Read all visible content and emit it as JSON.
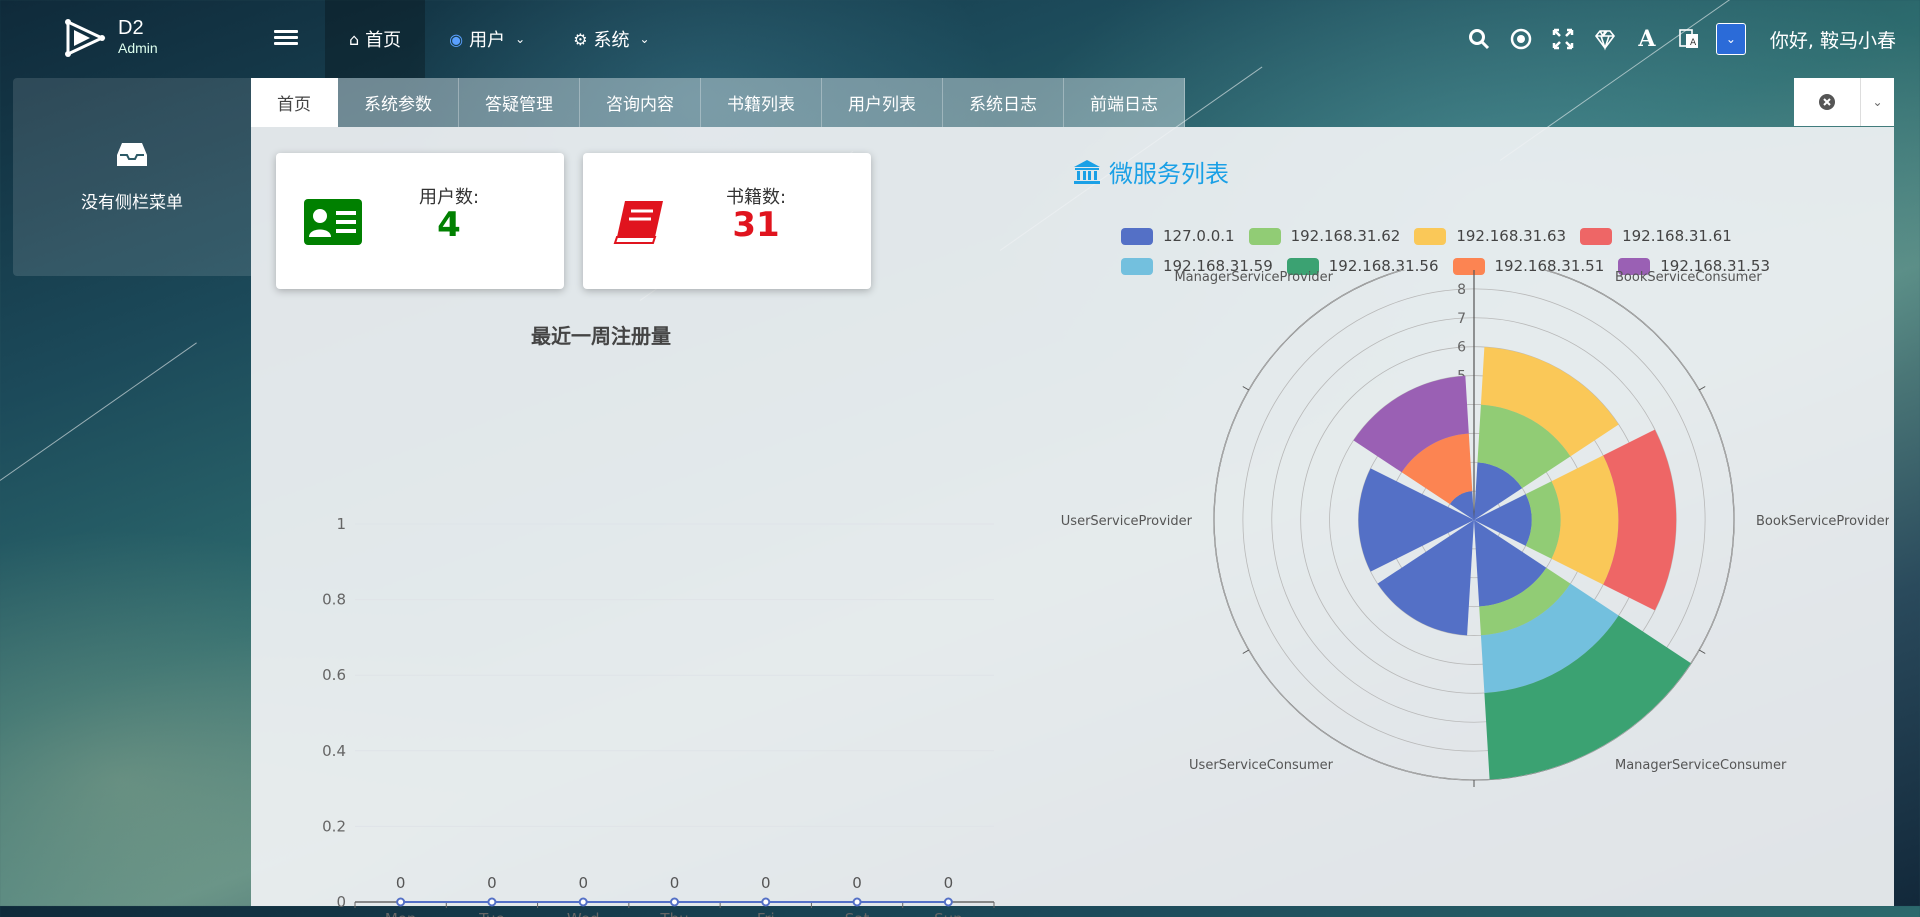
{
  "header": {
    "logo": {
      "name": "D2",
      "sub": "Admin"
    },
    "nav": [
      {
        "label": "首页",
        "icon": "home-icon"
      },
      {
        "label": "用户",
        "icon": "user-circle-icon",
        "dropdown": true
      },
      {
        "label": "系统",
        "icon": "gear-icon",
        "dropdown": true
      }
    ],
    "greeting": "你好, 鞍马小春"
  },
  "sidebar": {
    "empty_text": "没有侧栏菜单"
  },
  "tabs": [
    "首页",
    "系统参数",
    "答疑管理",
    "咨询内容",
    "书籍列表",
    "用户列表",
    "系统日志",
    "前端日志"
  ],
  "cards": [
    {
      "label": "用户数:",
      "value": "4",
      "color": "#008000",
      "icon": "id-card-icon"
    },
    {
      "label": "书籍数:",
      "value": "31",
      "color": "#e0141e",
      "icon": "book-icon"
    }
  ],
  "services_title": "微服务列表",
  "colors": {
    "accent": "#1aa0e6"
  },
  "chart_data": [
    {
      "type": "line",
      "title": "最近一周注册量",
      "categories": [
        "Mon",
        "Tue",
        "Wed",
        "Thu",
        "Fri",
        "Sat",
        "Sun"
      ],
      "values": [
        0,
        0,
        0,
        0,
        0,
        0,
        0
      ],
      "ylim": [
        0,
        1
      ],
      "yticks": [
        "0",
        "0.2",
        "0.4",
        "0.6",
        "0.8",
        "1"
      ],
      "grid": true,
      "color": "#5470c6"
    },
    {
      "type": "bar",
      "subtype": "stacked-polar",
      "categories": [
        "BookServiceConsumer",
        "BookServiceProvider",
        "ManagerServiceConsumer",
        "UserServiceConsumer",
        "UserServiceProvider",
        "ManagerServiceProvider"
      ],
      "rlim": [
        0,
        9
      ],
      "rticks": [
        "1",
        "2",
        "3",
        "4",
        "5",
        "6",
        "7",
        "8",
        "9"
      ],
      "legend_position": "top",
      "series": [
        {
          "name": "127.0.0.1",
          "color": "#5470c6",
          "values": [
            2,
            2,
            3,
            4,
            4,
            1
          ]
        },
        {
          "name": "192.168.31.62",
          "color": "#91cc75",
          "values": [
            2,
            1,
            1,
            0,
            0,
            0
          ]
        },
        {
          "name": "192.168.31.63",
          "color": "#fac858",
          "values": [
            2,
            2,
            0,
            0,
            0,
            0
          ]
        },
        {
          "name": "192.168.31.61",
          "color": "#ee6666",
          "values": [
            0,
            2,
            0,
            0,
            0,
            0
          ]
        },
        {
          "name": "192.168.31.59",
          "color": "#73c0de",
          "values": [
            0,
            0,
            2,
            0,
            0,
            0
          ]
        },
        {
          "name": "192.168.31.56",
          "color": "#3ba272",
          "values": [
            0,
            0,
            3,
            0,
            0,
            0
          ]
        },
        {
          "name": "192.168.31.51",
          "color": "#fc8452",
          "values": [
            0,
            0,
            0,
            0,
            0,
            2
          ]
        },
        {
          "name": "192.168.31.53",
          "color": "#9a60b4",
          "values": [
            0,
            0,
            0,
            0,
            0,
            2
          ]
        }
      ]
    }
  ]
}
